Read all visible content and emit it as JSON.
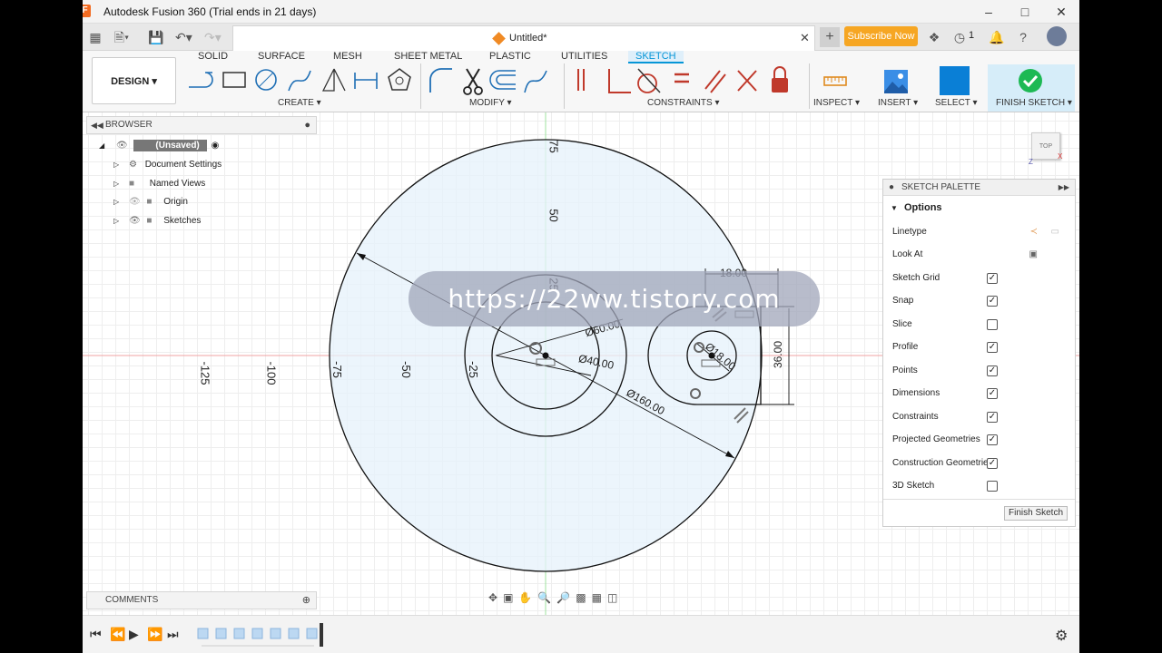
{
  "window": {
    "title": "Autodesk Fusion 360 (Trial ends in 21 days)"
  },
  "tabrow": {
    "doc_title": "Untitled*",
    "subscribe": "Subscribe Now",
    "jobs_count": "1"
  },
  "ribbon": {
    "tabs": [
      "SOLID",
      "SURFACE",
      "MESH",
      "SHEET METAL",
      "PLASTIC",
      "UTILITIES",
      "SKETCH"
    ],
    "design": "DESIGN ▾",
    "groups": {
      "create": "CREATE ▾",
      "modify": "MODIFY ▾",
      "constraints": "CONSTRAINTS ▾",
      "inspect": "INSPECT ▾",
      "insert": "INSERT ▾",
      "select": "SELECT ▾",
      "finish": "FINISH SKETCH ▾"
    }
  },
  "browser": {
    "title": "BROWSER",
    "root": "(Unsaved)",
    "items": [
      "Document Settings",
      "Named Views",
      "Origin",
      "Sketches"
    ]
  },
  "comments": {
    "title": "COMMENTS"
  },
  "viewcube": {
    "label": "TOP"
  },
  "palette": {
    "title": "SKETCH PALETTE",
    "section": "Options",
    "rows": [
      {
        "label": "Linetype",
        "type": "icon"
      },
      {
        "label": "Look At",
        "type": "icon"
      },
      {
        "label": "Sketch Grid",
        "checked": true
      },
      {
        "label": "Snap",
        "checked": true
      },
      {
        "label": "Slice",
        "checked": false
      },
      {
        "label": "Profile",
        "checked": true
      },
      {
        "label": "Points",
        "checked": true
      },
      {
        "label": "Dimensions",
        "checked": true
      },
      {
        "label": "Constraints",
        "checked": true
      },
      {
        "label": "Projected Geometries",
        "checked": true
      },
      {
        "label": "Construction Geometries",
        "checked": true
      },
      {
        "label": "3D Sketch",
        "checked": false
      }
    ],
    "finish_button": "Finish Sketch"
  },
  "sketch": {
    "axis_ticks_x": [
      "-125",
      "-100",
      "-75",
      "-50",
      "-25"
    ],
    "axis_ticks_y": [
      "75",
      "50",
      "25"
    ],
    "dims": {
      "d160": "Ø160.00",
      "d60": "Ø60.00",
      "d40": "Ø40.00",
      "d18": "Ø18.00",
      "w18": "18.00",
      "h36": "36.00"
    }
  },
  "watermark": "https://22ww.tistory.com",
  "colors": {
    "accent": "#0696d7",
    "subscribe": "#f6a623",
    "profile_fill": "#e6f1fb",
    "finish_green": "#1db954"
  }
}
